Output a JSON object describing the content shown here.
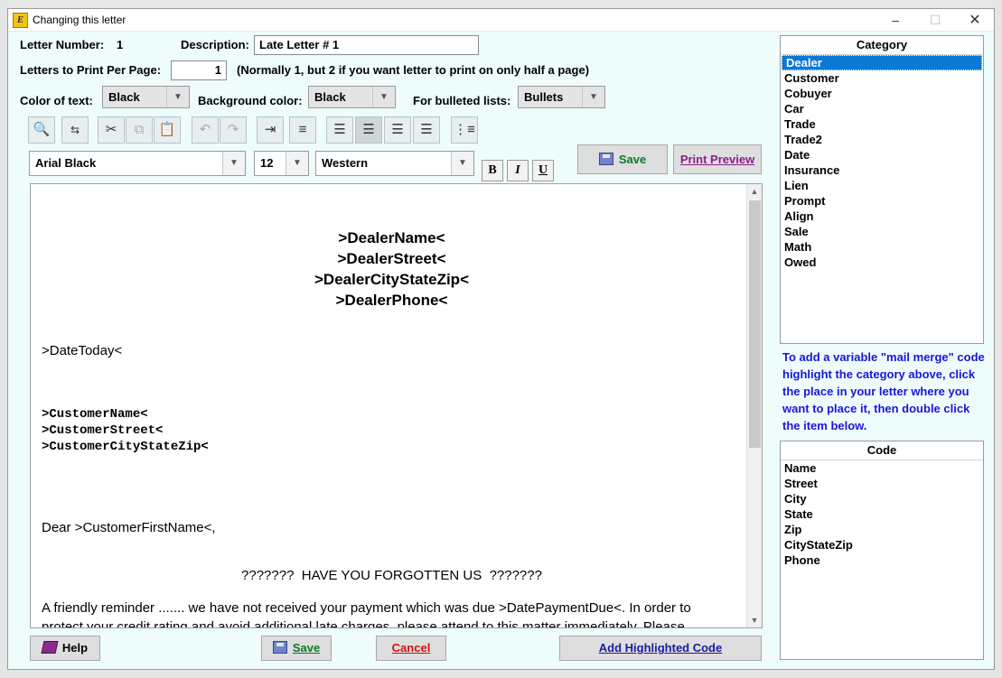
{
  "window": {
    "title": "Changing this letter",
    "minimize": "–",
    "maximize": "☐",
    "close": "✕"
  },
  "form": {
    "letter_number_label": "Letter Number:",
    "letter_number": "1",
    "description_label": "Description:",
    "description": "Late Letter # 1",
    "per_page_label": "Letters to Print Per Page:",
    "per_page": "1",
    "per_page_note": "(Normally 1, but 2 if you want letter to print on only half a page)",
    "text_color_label": "Color of text:",
    "text_color": "Black",
    "bg_color_label": "Background color:",
    "bg_color": "Black",
    "bullets_label": "For bulleted lists:",
    "bullets": "Bullets"
  },
  "toolbar": {
    "icons": [
      "find-icon",
      "replace-icon",
      "cut-icon",
      "copy-icon",
      "paste-icon",
      "undo-icon",
      "redo-icon",
      "indent-icon",
      "outdent-icon",
      "align-left-icon",
      "align-center-icon",
      "align-right-icon",
      "justify-icon",
      "bullet-list-icon"
    ],
    "font": "Arial Black",
    "size": "12",
    "script": "Western",
    "bold": "B",
    "italic": "I",
    "underline": "U",
    "save": "Save",
    "print_preview": "Print Preview"
  },
  "letter": {
    "dealer_name": ">DealerName<",
    "dealer_street": ">DealerStreet<",
    "dealer_city": ">DealerCityStateZip<",
    "dealer_phone": ">DealerPhone<",
    "date": ">DateToday<",
    "customer_name": ">CustomerName<",
    "customer_street": ">CustomerStreet<",
    "customer_city": ">CustomerCityStateZip<",
    "greeting": "Dear >CustomerFirstName<,",
    "heading": "???????  HAVE YOU FORGOTTEN US  ???????",
    "body_line1": "A friendly reminder ....... we have not received your payment which was due >DatePaymentDue<.  In order to",
    "body_line2": "protect your credit rating and avoid additional late charges, please attend to this matter immediately.  Please"
  },
  "category": {
    "header": "Category",
    "items": [
      "Dealer",
      "Customer",
      "Cobuyer",
      "Car",
      "Trade",
      "Trade2",
      "Date",
      "Insurance",
      "Lien",
      "Prompt",
      "Align",
      "Sale",
      "Math",
      "Owed"
    ],
    "selected": "Dealer"
  },
  "hint": "To add a variable \"mail merge\" code highlight the category above, click the place in your letter where you want to place it, then double click the item below.",
  "code": {
    "header": "Code",
    "items": [
      "Name",
      "Street",
      "City",
      "State",
      "Zip",
      "CityStateZip",
      "Phone"
    ]
  },
  "footer": {
    "help": "Help",
    "save": "Save",
    "cancel": "Cancel",
    "add_code": "Add Highlighted Code"
  },
  "colors": {
    "print_preview": "#8a1f8a",
    "save": "#0a7a2a",
    "cancel": "#d01010",
    "add_code": "#1a1aa0",
    "hint": "#1717d8",
    "selection": "#0a78d7"
  }
}
